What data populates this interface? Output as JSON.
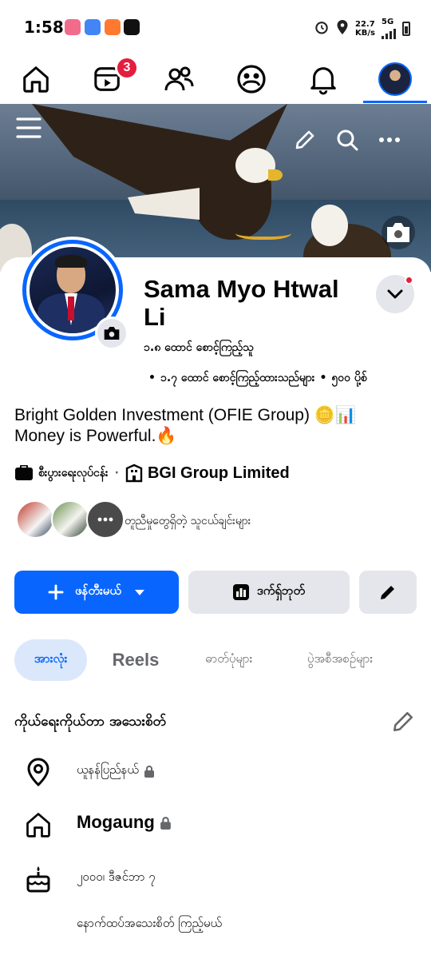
{
  "status_bar": {
    "time": "1:58",
    "speed_value": "22.7",
    "speed_unit": "KB/s",
    "network": "5G",
    "app_colors": [
      "#f26b8a",
      "#4285f4",
      "#ff7a2f",
      "#1db954"
    ]
  },
  "nav": {
    "tabs": [
      "home-icon",
      "reels-icon",
      "friends-icon",
      "groups-icon",
      "notifications-icon",
      "profile-avatar"
    ],
    "reels_badge": "3",
    "active_tab": "profile-avatar",
    "accent": "#0866ff"
  },
  "profile": {
    "name": "Sama Myo Htwal Li",
    "followers": "၁.၈ ထောင် စောင့်ကြည့်သူ",
    "following": "၁.၇ ထောင် စောင့်ကြည့်ထားသည်များ",
    "posts": "၅၀၀ ပို့စ်",
    "bio_line1": "Bright Golden Investment (OFIE Group) 🪙📊",
    "bio_line2": "Money is Powerful.🔥",
    "work_category": "စီးပွားရေးလုပ်ငန်း",
    "company": "BGI Group Limited",
    "mutual_friends": "တူညီမှုတွေရှိတဲ့ သူငယ်ချင်းများ"
  },
  "actions": {
    "add_story": "ဖန်တီးမယ်",
    "insights": "ဒက်ရှ်ဘုတ်"
  },
  "tabs": {
    "all": "အားလုံး",
    "reels": "Reels",
    "photos": "ဓာတ်ပုံများ",
    "events": "ပွဲအစီအစဉ်များ"
  },
  "details": {
    "title": "ကိုယ်ရေးကိုယ်တာ အသေးစိတ်",
    "location": "ယူနန်ပြည်နယ်",
    "hometown": "Mogaung",
    "birthday": "၂၀၀၀၊ ဒီဇင်ဘာ ၇",
    "see_more": "နောက်ထပ်အသေးစိတ် ကြည့်မယ်"
  }
}
